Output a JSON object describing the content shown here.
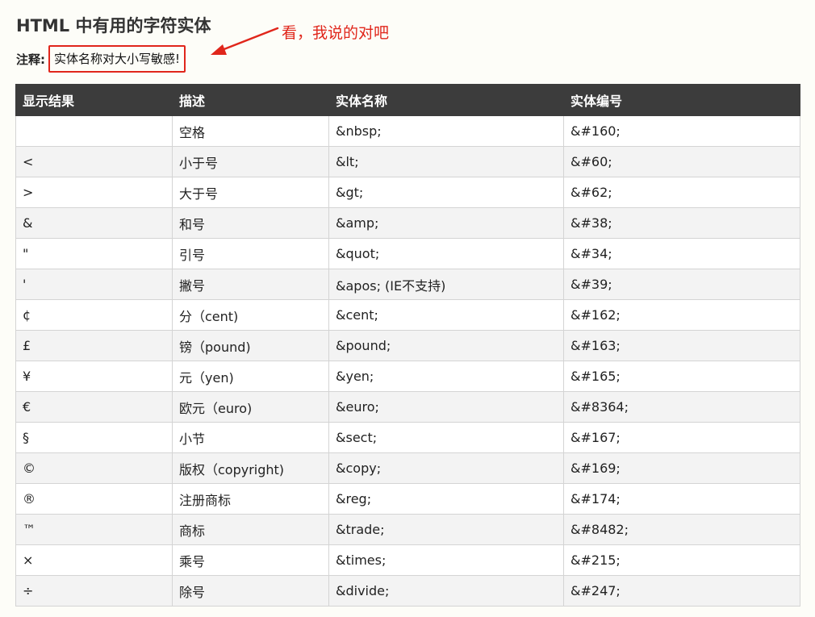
{
  "page": {
    "title": "HTML 中有用的字符实体",
    "note_label": "注释:",
    "note_text": "实体名称对大小写敏感!",
    "annotation": "看，我说的对吧",
    "accent_color": "#e0261b",
    "header_bg": "#3c3c3c"
  },
  "table": {
    "headers": [
      "显示结果",
      "描述",
      "实体名称",
      "实体编号"
    ],
    "rows": [
      [
        " ",
        "空格",
        "&nbsp;",
        "&#160;"
      ],
      [
        "<",
        "小于号",
        "&lt;",
        "&#60;"
      ],
      [
        ">",
        "大于号",
        "&gt;",
        "&#62;"
      ],
      [
        "&",
        "和号",
        "&amp;",
        "&#38;"
      ],
      [
        "\"",
        "引号",
        "&quot;",
        "&#34;"
      ],
      [
        "'",
        "撇号",
        "&apos; (IE不支持)",
        "&#39;"
      ],
      [
        "¢",
        "分（cent)",
        "&cent;",
        "&#162;"
      ],
      [
        "£",
        "镑（pound)",
        "&pound;",
        "&#163;"
      ],
      [
        "¥",
        "元（yen)",
        "&yen;",
        "&#165;"
      ],
      [
        "€",
        "欧元（euro)",
        "&euro;",
        "&#8364;"
      ],
      [
        "§",
        "小节",
        "&sect;",
        "&#167;"
      ],
      [
        "©",
        "版权（copyright)",
        "&copy;",
        "&#169;"
      ],
      [
        "®",
        "注册商标",
        "&reg;",
        "&#174;"
      ],
      [
        "™",
        "商标",
        "&trade;",
        "&#8482;"
      ],
      [
        "×",
        "乘号",
        "&times;",
        "&#215;"
      ],
      [
        "÷",
        "除号",
        "&divide;",
        "&#247;"
      ]
    ]
  }
}
